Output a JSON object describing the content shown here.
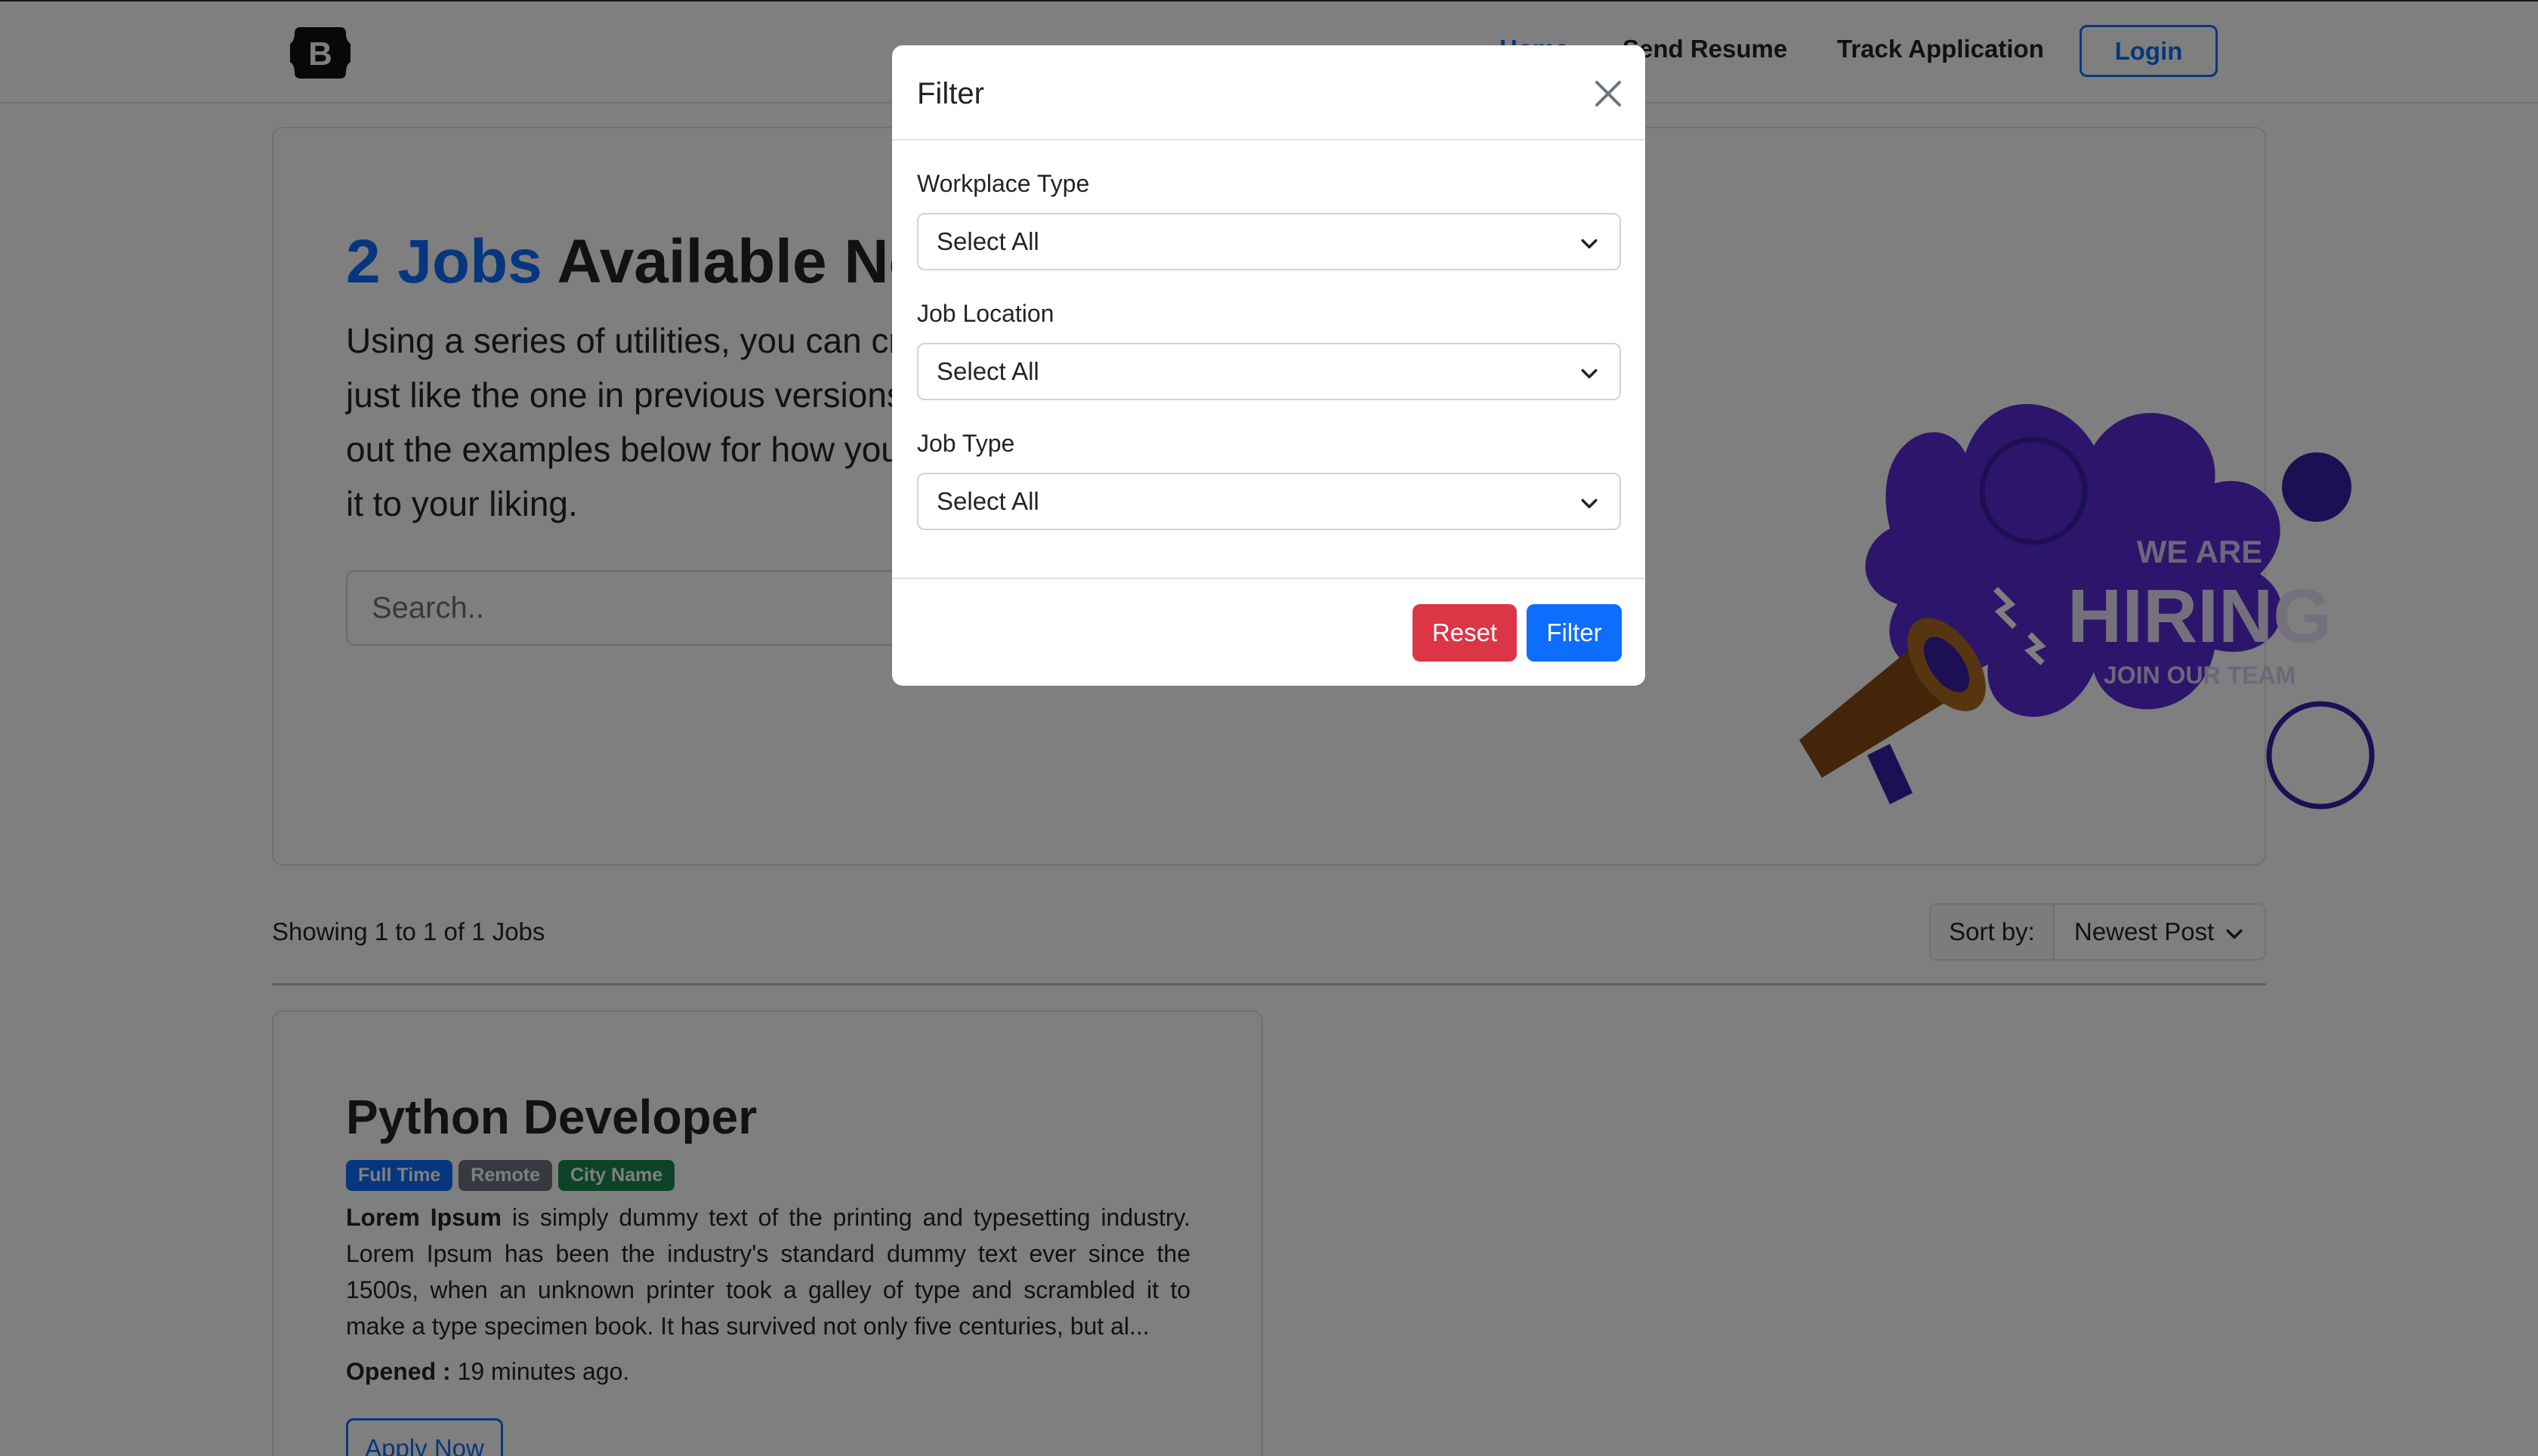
{
  "navbar": {
    "brand_letter": "B",
    "home_label": "Home",
    "send_resume_label": "Send Resume",
    "track_application_label": "Track Application",
    "login_label": "Login"
  },
  "hero": {
    "count_text": "2 Jobs",
    "title_rest": " Available Now",
    "description": "Using a series of utilities, you can create this jumbotron, just like the one in previous versions of Bootstrap. Check out the examples below for how you can remix and restyle it to your liking.",
    "search_placeholder": "Search..",
    "art": {
      "line1": "WE ARE",
      "line2": "HIRING",
      "line3": "JOIN OUR TEAM",
      "blob_color": "#5b2bd6",
      "accent_color": "#3a1fa8"
    }
  },
  "listing": {
    "showing_text": "Showing 1 to 1 of 1 Jobs",
    "sort_label": "Sort by:",
    "sort_value": "Newest Post"
  },
  "job": {
    "title": "Python Developer",
    "badges": [
      "Full Time",
      "Remote",
      "City Name"
    ],
    "desc_bold": "Lorem Ipsum",
    "desc_rest": " is simply dummy text of the printing and typesetting industry. Lorem Ipsum has been the industry's standard dummy text ever since the 1500s, when an unknown printer took a galley of type and scrambled it to make a type specimen book. It has survived not only five centuries, but al...",
    "opened_label": "Opened :",
    "opened_value": " 19 minutes ago.",
    "apply_label": "Apply Now"
  },
  "modal": {
    "title": "Filter",
    "fields": [
      {
        "label": "Workplace Type",
        "value": "Select All"
      },
      {
        "label": "Job Location",
        "value": "Select All"
      },
      {
        "label": "Job Type",
        "value": "Select All"
      }
    ],
    "reset_label": "Reset",
    "filter_label": "Filter"
  },
  "colors": {
    "primary": "#0d6efd",
    "danger": "#dc3545",
    "secondary": "#6c757d",
    "success": "#198754"
  },
  "icons": {
    "close": "close-icon",
    "chevron": "chevron-down-icon",
    "brand": "bootstrap-logo-icon",
    "megaphone": "megaphone-icon"
  }
}
